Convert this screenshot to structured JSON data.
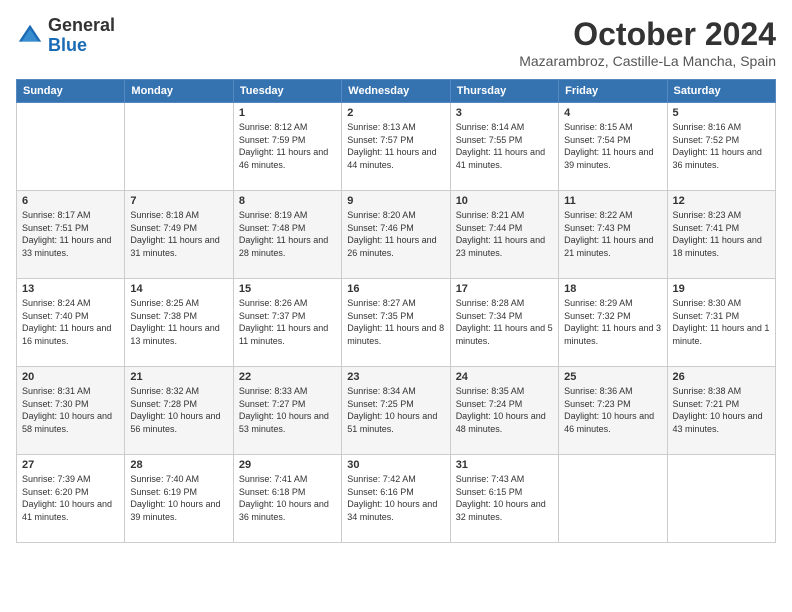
{
  "logo": {
    "general": "General",
    "blue": "Blue"
  },
  "header": {
    "month": "October 2024",
    "location": "Mazarambroz, Castille-La Mancha, Spain"
  },
  "days_of_week": [
    "Sunday",
    "Monday",
    "Tuesday",
    "Wednesday",
    "Thursday",
    "Friday",
    "Saturday"
  ],
  "weeks": [
    {
      "days": [
        {
          "num": "",
          "info": ""
        },
        {
          "num": "",
          "info": ""
        },
        {
          "num": "1",
          "info": "Sunrise: 8:12 AM\nSunset: 7:59 PM\nDaylight: 11 hours and 46 minutes."
        },
        {
          "num": "2",
          "info": "Sunrise: 8:13 AM\nSunset: 7:57 PM\nDaylight: 11 hours and 44 minutes."
        },
        {
          "num": "3",
          "info": "Sunrise: 8:14 AM\nSunset: 7:55 PM\nDaylight: 11 hours and 41 minutes."
        },
        {
          "num": "4",
          "info": "Sunrise: 8:15 AM\nSunset: 7:54 PM\nDaylight: 11 hours and 39 minutes."
        },
        {
          "num": "5",
          "info": "Sunrise: 8:16 AM\nSunset: 7:52 PM\nDaylight: 11 hours and 36 minutes."
        }
      ]
    },
    {
      "days": [
        {
          "num": "6",
          "info": "Sunrise: 8:17 AM\nSunset: 7:51 PM\nDaylight: 11 hours and 33 minutes."
        },
        {
          "num": "7",
          "info": "Sunrise: 8:18 AM\nSunset: 7:49 PM\nDaylight: 11 hours and 31 minutes."
        },
        {
          "num": "8",
          "info": "Sunrise: 8:19 AM\nSunset: 7:48 PM\nDaylight: 11 hours and 28 minutes."
        },
        {
          "num": "9",
          "info": "Sunrise: 8:20 AM\nSunset: 7:46 PM\nDaylight: 11 hours and 26 minutes."
        },
        {
          "num": "10",
          "info": "Sunrise: 8:21 AM\nSunset: 7:44 PM\nDaylight: 11 hours and 23 minutes."
        },
        {
          "num": "11",
          "info": "Sunrise: 8:22 AM\nSunset: 7:43 PM\nDaylight: 11 hours and 21 minutes."
        },
        {
          "num": "12",
          "info": "Sunrise: 8:23 AM\nSunset: 7:41 PM\nDaylight: 11 hours and 18 minutes."
        }
      ]
    },
    {
      "days": [
        {
          "num": "13",
          "info": "Sunrise: 8:24 AM\nSunset: 7:40 PM\nDaylight: 11 hours and 16 minutes."
        },
        {
          "num": "14",
          "info": "Sunrise: 8:25 AM\nSunset: 7:38 PM\nDaylight: 11 hours and 13 minutes."
        },
        {
          "num": "15",
          "info": "Sunrise: 8:26 AM\nSunset: 7:37 PM\nDaylight: 11 hours and 11 minutes."
        },
        {
          "num": "16",
          "info": "Sunrise: 8:27 AM\nSunset: 7:35 PM\nDaylight: 11 hours and 8 minutes."
        },
        {
          "num": "17",
          "info": "Sunrise: 8:28 AM\nSunset: 7:34 PM\nDaylight: 11 hours and 5 minutes."
        },
        {
          "num": "18",
          "info": "Sunrise: 8:29 AM\nSunset: 7:32 PM\nDaylight: 11 hours and 3 minutes."
        },
        {
          "num": "19",
          "info": "Sunrise: 8:30 AM\nSunset: 7:31 PM\nDaylight: 11 hours and 1 minute."
        }
      ]
    },
    {
      "days": [
        {
          "num": "20",
          "info": "Sunrise: 8:31 AM\nSunset: 7:30 PM\nDaylight: 10 hours and 58 minutes."
        },
        {
          "num": "21",
          "info": "Sunrise: 8:32 AM\nSunset: 7:28 PM\nDaylight: 10 hours and 56 minutes."
        },
        {
          "num": "22",
          "info": "Sunrise: 8:33 AM\nSunset: 7:27 PM\nDaylight: 10 hours and 53 minutes."
        },
        {
          "num": "23",
          "info": "Sunrise: 8:34 AM\nSunset: 7:25 PM\nDaylight: 10 hours and 51 minutes."
        },
        {
          "num": "24",
          "info": "Sunrise: 8:35 AM\nSunset: 7:24 PM\nDaylight: 10 hours and 48 minutes."
        },
        {
          "num": "25",
          "info": "Sunrise: 8:36 AM\nSunset: 7:23 PM\nDaylight: 10 hours and 46 minutes."
        },
        {
          "num": "26",
          "info": "Sunrise: 8:38 AM\nSunset: 7:21 PM\nDaylight: 10 hours and 43 minutes."
        }
      ]
    },
    {
      "days": [
        {
          "num": "27",
          "info": "Sunrise: 7:39 AM\nSunset: 6:20 PM\nDaylight: 10 hours and 41 minutes."
        },
        {
          "num": "28",
          "info": "Sunrise: 7:40 AM\nSunset: 6:19 PM\nDaylight: 10 hours and 39 minutes."
        },
        {
          "num": "29",
          "info": "Sunrise: 7:41 AM\nSunset: 6:18 PM\nDaylight: 10 hours and 36 minutes."
        },
        {
          "num": "30",
          "info": "Sunrise: 7:42 AM\nSunset: 6:16 PM\nDaylight: 10 hours and 34 minutes."
        },
        {
          "num": "31",
          "info": "Sunrise: 7:43 AM\nSunset: 6:15 PM\nDaylight: 10 hours and 32 minutes."
        },
        {
          "num": "",
          "info": ""
        },
        {
          "num": "",
          "info": ""
        }
      ]
    }
  ]
}
